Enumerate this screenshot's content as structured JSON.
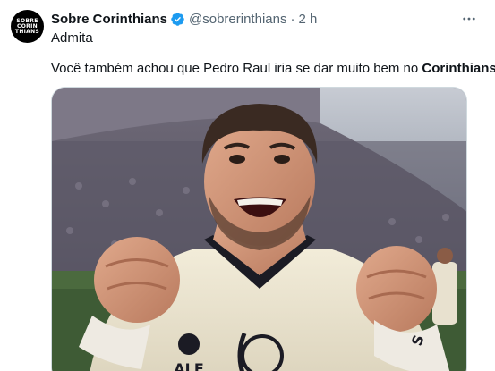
{
  "tweet": {
    "display_name": "Sobre Corinthians",
    "handle": "@sobrerinthians",
    "separator": "·",
    "time": "2 h",
    "subtitle": "Admita",
    "text_prefix": "Você também achou que Pedro Raul iria se dar muito bem no ",
    "text_bold": "Corinthians",
    "avatar_logo_lines": [
      "SOBRE",
      "CORIN",
      "THIANS"
    ],
    "verified_color": "#1d9bf0",
    "icons": {
      "verified": "verified-badge-icon",
      "more": "more-options-icon"
    }
  },
  "media": {
    "jersey_logo": "ALE",
    "kit_letter": "S"
  }
}
